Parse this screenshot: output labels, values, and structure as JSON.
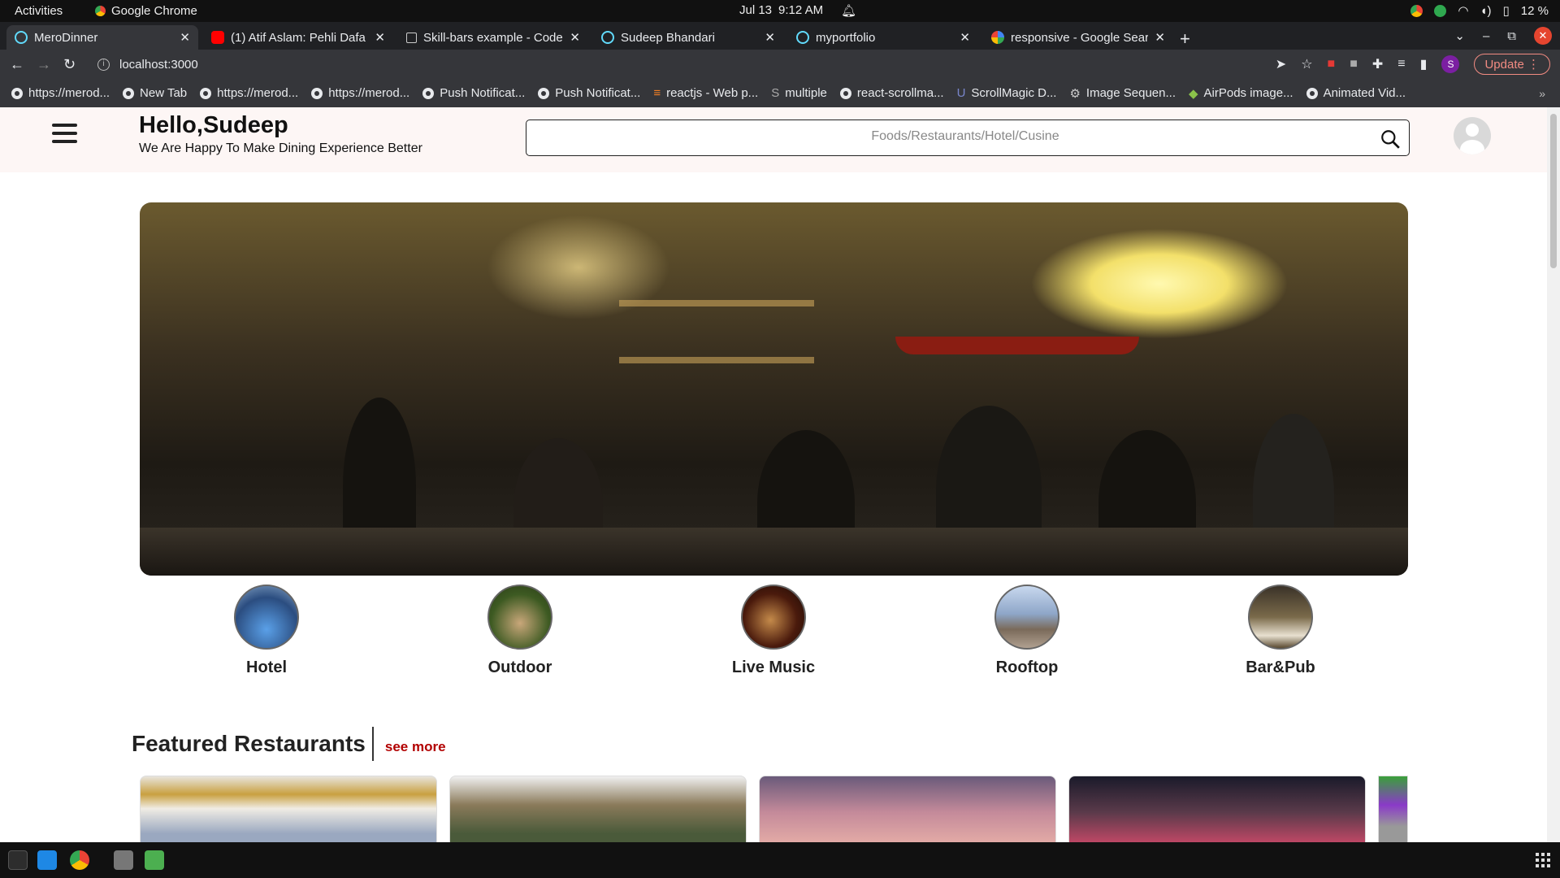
{
  "system": {
    "activities": "Activities",
    "app_name": "Google Chrome",
    "date": "Jul 13",
    "time": "9:12 AM",
    "battery": "12 %"
  },
  "tabs": [
    {
      "title": "MeroDinner",
      "active": true
    },
    {
      "title": "(1) Atif Aslam: Pehli Dafa",
      "active": false
    },
    {
      "title": "Skill-bars example - CodeS",
      "active": false
    },
    {
      "title": "Sudeep Bhandari",
      "active": false
    },
    {
      "title": "myportfolio",
      "active": false
    },
    {
      "title": "responsive - Google Searc",
      "active": false
    }
  ],
  "address_bar": {
    "url": "localhost:3000",
    "profile_initial": "S",
    "update_label": "Update"
  },
  "bookmarks": [
    "https://merod...",
    "New Tab",
    "https://merod...",
    "https://merod...",
    "Push Notificat...",
    "Push Notificat...",
    "reactjs - Web p...",
    "multiple",
    "react-scrollma...",
    "ScrollMagic D...",
    "Image Sequen...",
    "AirPods image...",
    "Animated Vid..."
  ],
  "page": {
    "greeting": "Hello,Sudeep",
    "subtitle": "We Are Happy To Make Dining Experience Better",
    "search_placeholder": "Foods/Restaurants/Hotel/Cusine",
    "categories": [
      {
        "label": "Hotel",
        "color": "#4a7fc4"
      },
      {
        "label": "Outdoor",
        "color": "#6b5a2a"
      },
      {
        "label": "Live Music",
        "color": "#3a1a10"
      },
      {
        "label": "Rooftop",
        "color": "#8ea6c8"
      },
      {
        "label": "Bar&Pub",
        "color": "#5a4a30"
      }
    ],
    "featured_title": "Featured Restaurants",
    "see_more": "see more"
  },
  "colors": {
    "accent": "#b20000",
    "header_bg": "#fdf6f5",
    "chrome_dark": "#202124",
    "chrome_toolbar": "#35363a"
  }
}
